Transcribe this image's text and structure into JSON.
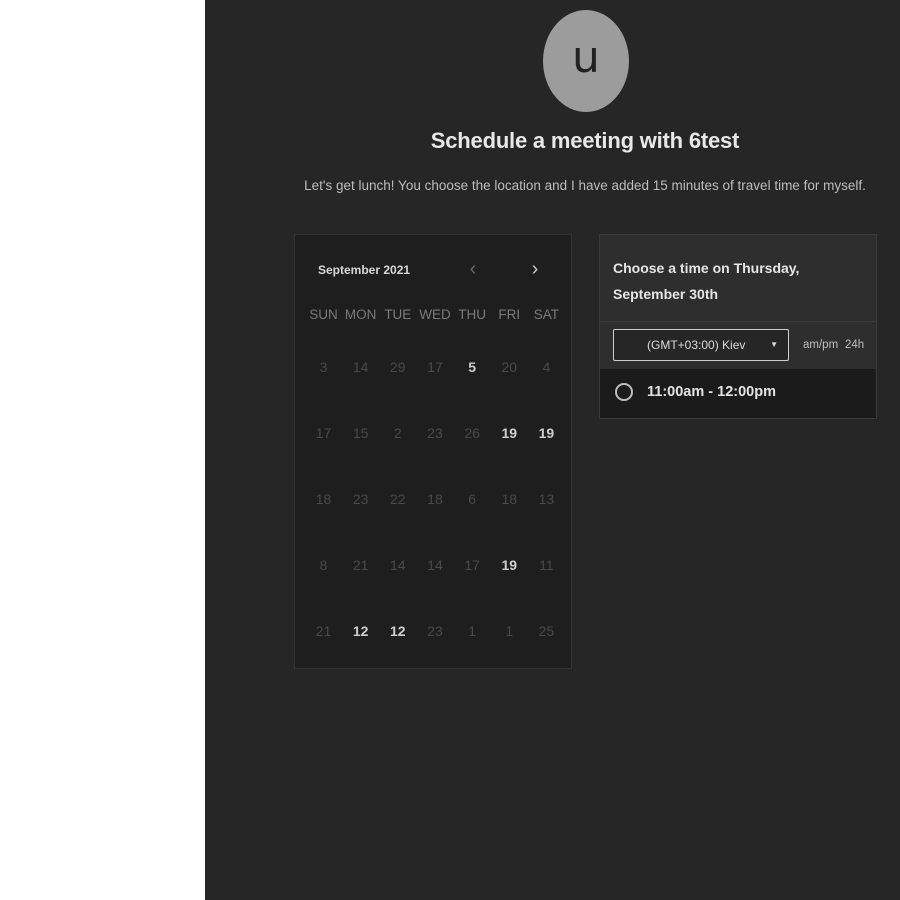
{
  "avatar": {
    "initial": "u"
  },
  "header": {
    "title": "Schedule a meeting with 6test",
    "subtitle": "Let's get lunch! You choose the location and I have added 15 minutes of travel time for myself."
  },
  "calendar": {
    "month_label": "September 2021",
    "prev_icon": "chevron-left-icon",
    "next_icon": "chevron-right-icon",
    "weekdays": [
      "SUN",
      "MON",
      "TUE",
      "WED",
      "THU",
      "FRI",
      "SAT"
    ],
    "weeks": [
      [
        {
          "d": "3",
          "on": false
        },
        {
          "d": "14",
          "on": false
        },
        {
          "d": "29",
          "on": false
        },
        {
          "d": "17",
          "on": false
        },
        {
          "d": "5",
          "on": true
        },
        {
          "d": "20",
          "on": false
        },
        {
          "d": "4",
          "on": false
        }
      ],
      [
        {
          "d": "17",
          "on": false
        },
        {
          "d": "15",
          "on": false
        },
        {
          "d": "2",
          "on": false
        },
        {
          "d": "23",
          "on": false
        },
        {
          "d": "26",
          "on": false
        },
        {
          "d": "19",
          "on": true
        },
        {
          "d": "19",
          "on": true
        }
      ],
      [
        {
          "d": "18",
          "on": false
        },
        {
          "d": "23",
          "on": false
        },
        {
          "d": "22",
          "on": false
        },
        {
          "d": "18",
          "on": false
        },
        {
          "d": "6",
          "on": false
        },
        {
          "d": "18",
          "on": false
        },
        {
          "d": "13",
          "on": false
        }
      ],
      [
        {
          "d": "8",
          "on": false
        },
        {
          "d": "21",
          "on": false
        },
        {
          "d": "14",
          "on": false
        },
        {
          "d": "14",
          "on": false
        },
        {
          "d": "17",
          "on": false
        },
        {
          "d": "19",
          "on": true
        },
        {
          "d": "11",
          "on": false
        }
      ],
      [
        {
          "d": "21",
          "on": false
        },
        {
          "d": "12",
          "on": true
        },
        {
          "d": "12",
          "on": true
        },
        {
          "d": "23",
          "on": false
        },
        {
          "d": "1",
          "on": false
        },
        {
          "d": "1",
          "on": false
        },
        {
          "d": "25",
          "on": false
        }
      ]
    ]
  },
  "times": {
    "heading_line1": "Choose a time on Thursday,",
    "heading_line2": "September 30th",
    "timezone": "(GMT+03:00) Kiev",
    "format_ampm": "am/pm",
    "format_24h": "24h",
    "slots": [
      "11:00am - 12:00pm"
    ]
  }
}
